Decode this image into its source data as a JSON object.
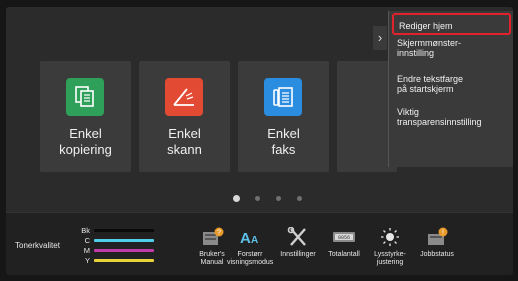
{
  "tiles": [
    {
      "label": "Enkel\nkopiering",
      "icon": "copy-icon",
      "color": "#2fa05a"
    },
    {
      "label": "Enkel\nskann",
      "icon": "scan-icon",
      "color": "#e34a33"
    },
    {
      "label": "Enkel\nfaks",
      "icon": "fax-icon",
      "color": "#2b8de0"
    }
  ],
  "menu": {
    "arrow": "›",
    "items": [
      "Rediger hjem",
      "Skjermmønster-\ninnstilling",
      "Endre tekstfarge\npå startskjerm",
      "Viktig\ntransparensinnstilling"
    ]
  },
  "pager": {
    "count": 4,
    "active_index": 0
  },
  "toner": {
    "label": "Tonerkvalitet",
    "rows": [
      {
        "letter": "Bk",
        "color": "#0a0a0a"
      },
      {
        "letter": "C",
        "color": "#4fd0e8"
      },
      {
        "letter": "M",
        "color": "#c03aa8"
      },
      {
        "letter": "Y",
        "color": "#e8d23a"
      }
    ]
  },
  "shortcuts": [
    {
      "label": "Bruker's\nManual",
      "icon": "manual-icon"
    },
    {
      "label": "Forstørr\nvisningsmodus",
      "icon": "text-size-icon"
    },
    {
      "label": "Innstillinger",
      "icon": "tools-icon"
    },
    {
      "label": "Totalantall",
      "icon": "counter-icon"
    },
    {
      "label": "Lysstyrke-\njustering",
      "icon": "brightness-icon"
    },
    {
      "label": "Jobbstatus",
      "icon": "job-status-icon"
    }
  ]
}
